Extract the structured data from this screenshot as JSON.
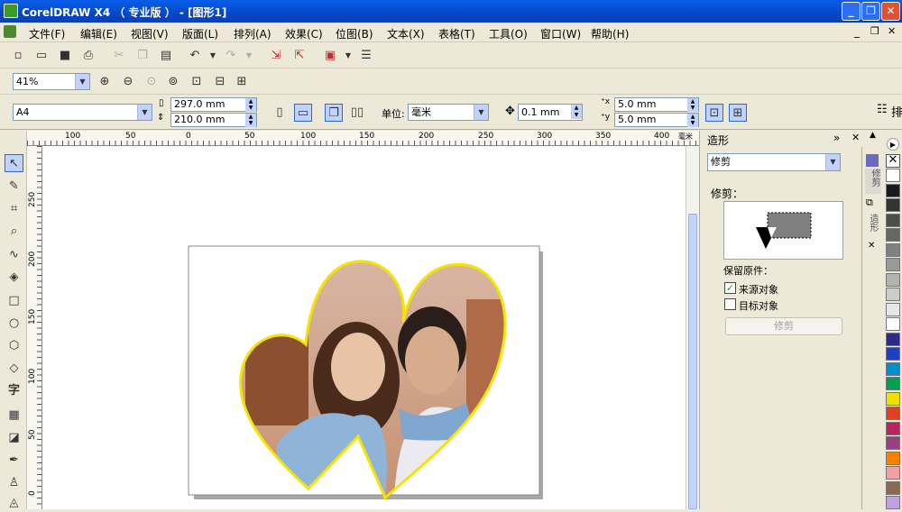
{
  "title": "CorelDRAW X4 （ 专业版 ） - [图形1]",
  "menu": [
    "文件(F)",
    "编辑(E)",
    "视图(V)",
    "版面(L)",
    "排列(A)",
    "效果(C)",
    "位图(B)",
    "文本(X)",
    "表格(T)",
    "工具(O)",
    "窗口(W)",
    "帮助(H)"
  ],
  "zoom": "41%",
  "paper": {
    "size": "A4",
    "width": "297.0 mm",
    "height": "210.0 mm",
    "units_label": "单位:",
    "units": "毫米",
    "nudge": "0.1 mm",
    "dup_x": "5.0 mm",
    "dup_y": "5.0 mm"
  },
  "partial_label": "排",
  "hruler": [
    "100",
    "50",
    "0",
    "50",
    "100",
    "150",
    "200",
    "250",
    "300",
    "350",
    "400"
  ],
  "hruler_unit": "毫米",
  "vruler": [
    "250",
    "200",
    "150",
    "100",
    "50",
    "0"
  ],
  "docker": {
    "title": "造形",
    "mode": "修剪",
    "section_label": "修剪：",
    "keep_label": "保留原件：",
    "source_label": "来源对象",
    "target_label": "目标对象",
    "apply_label": "修剪",
    "tab1": "修剪",
    "tab2": "造形"
  },
  "palette": [
    "#ffffff",
    "#1a1a1a",
    "#333333",
    "#4d4d4d",
    "#666666",
    "#808080",
    "#999999",
    "#b3b3b3",
    "#cccccc",
    "#e6e6e6",
    "#ffffff",
    "#2b2b8c",
    "#1f3fbf",
    "#0090d0",
    "#00a050",
    "#f0e000",
    "#e04020",
    "#c02060",
    "#9a4080",
    "#ff8000",
    "#f0a0a0",
    "#8c6a50",
    "#c0a0e0"
  ],
  "colors": {
    "title_bar": "#0547c9",
    "heart_outline": "#f5e400",
    "field_border": "#7f9db9"
  }
}
